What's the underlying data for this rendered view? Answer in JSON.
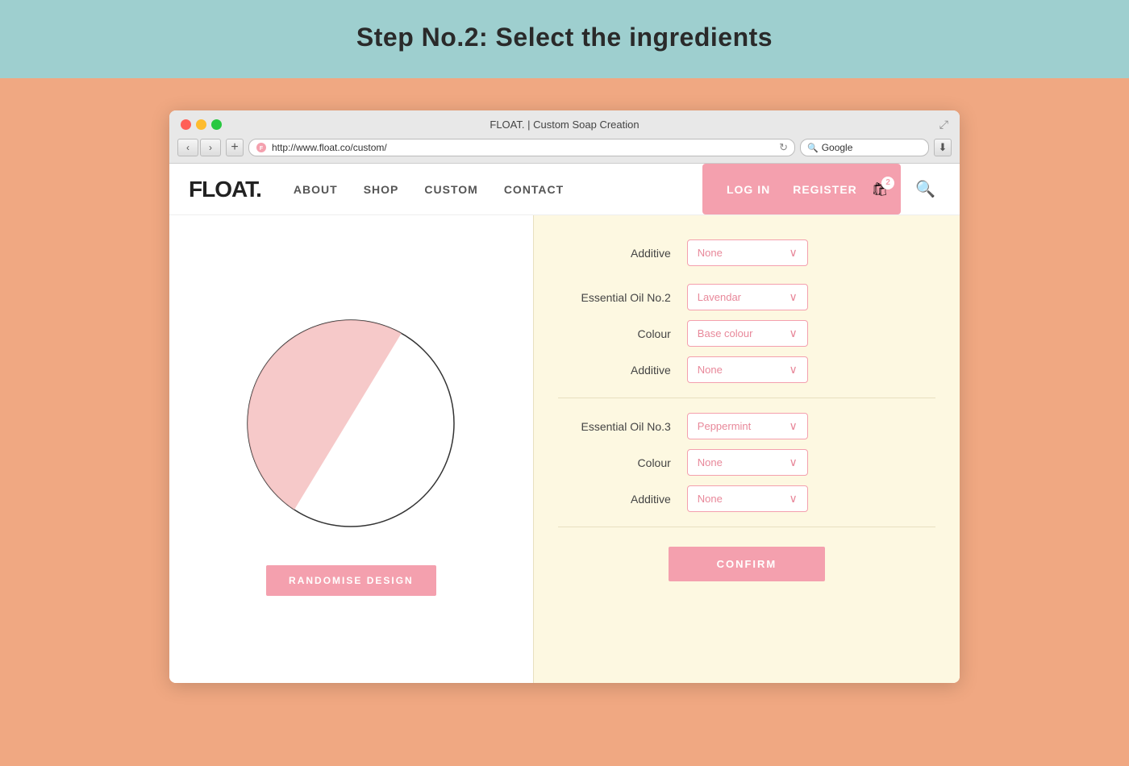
{
  "page": {
    "instruction_title": "Step No.2: Select the ingredients",
    "browser_tab": "FLOAT. | Custom Soap Creation",
    "url": "http://www.float.co/custom/",
    "search_placeholder": "Google"
  },
  "nav": {
    "logo": "FLOAT.",
    "links": [
      "ABOUT",
      "SHOP",
      "CUSTOM",
      "CONTACT"
    ],
    "actions": [
      "LOG IN",
      "REGISTER"
    ],
    "cart_count": "2"
  },
  "left_panel": {
    "randomise_btn": "RANDOMISE DESIGN"
  },
  "right_panel": {
    "top_partial_label": "Additive",
    "top_partial_value": "None",
    "groups": [
      {
        "id": "oil2",
        "rows": [
          {
            "label": "Essential Oil No.2",
            "value": "Lavendar"
          },
          {
            "label": "Colour",
            "value": "Base colour"
          },
          {
            "label": "Additive",
            "value": "None"
          }
        ]
      },
      {
        "id": "oil3",
        "rows": [
          {
            "label": "Essential Oil No.3",
            "value": "Peppermint"
          },
          {
            "label": "Colour",
            "value": "None"
          },
          {
            "label": "Additive",
            "value": "None"
          }
        ]
      }
    ],
    "confirm_btn": "CONFIRM"
  },
  "colors": {
    "pink": "#f4a0ae",
    "cream": "#fdf8e1",
    "teal": "#9ecfcf",
    "peach": "#f0a882"
  }
}
